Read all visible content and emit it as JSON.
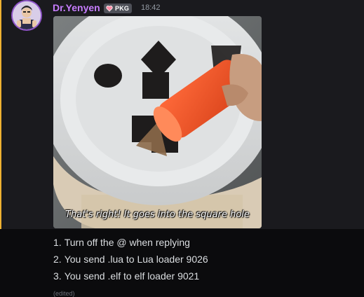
{
  "message": {
    "author": "Dr.Yenyen",
    "role_tag": "PKG",
    "timestamp": "18:42",
    "accent_color": "#f0b232",
    "username_color": "#c77dff",
    "image": {
      "description_icon": "gif-image",
      "caption": "That's right! It goes into the square hole"
    },
    "list": [
      {
        "num": "1.",
        "text": "Turn off the @ when replying"
      },
      {
        "num": "2.",
        "text": "You send .lua to Lua loader 9026"
      },
      {
        "num": "3.",
        "text": "You send .elf to elf loader 9021"
      }
    ],
    "edited": "(edited)"
  }
}
